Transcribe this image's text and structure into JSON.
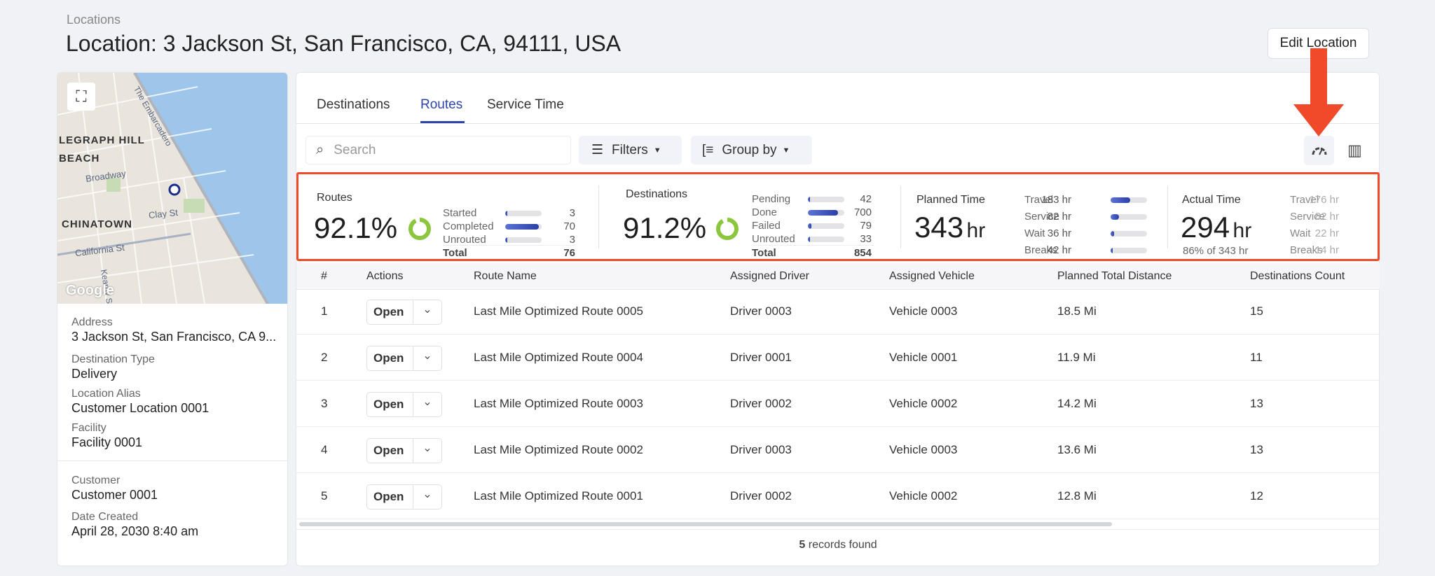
{
  "breadcrumb": "Locations",
  "page_title": "Location: 3 Jackson St, San Francisco, CA, 94111, USA",
  "edit_button": "Edit Location",
  "map": {
    "labels": [
      "LEGRAPH HILL",
      "BEACH",
      "Broadway",
      "CHINATOWN",
      "Clay St",
      "California St",
      "The Embarcadero",
      "Kearny St"
    ],
    "logo": "Google"
  },
  "details": [
    {
      "label": "Address",
      "value": "3 Jackson St, San Francisco, CA 9..."
    },
    {
      "label": "Destination Type",
      "value": "Delivery"
    },
    {
      "label": "Location Alias",
      "value": "Customer Location 0001"
    },
    {
      "label": "Facility",
      "value": "Facility 0001"
    },
    {
      "label": "Customer",
      "value": "Customer 0001"
    },
    {
      "label": "Date Created",
      "value": "April 28, 2030 8:40 am"
    }
  ],
  "tabs": [
    {
      "label": "Destinations"
    },
    {
      "label": "Routes",
      "active": true
    },
    {
      "label": "Service Time"
    }
  ],
  "toolbar": {
    "search_placeholder": "Search",
    "filters": "Filters",
    "group_by": "Group by"
  },
  "summary": {
    "routes": {
      "title": "Routes",
      "percent": "92.1%",
      "rows": [
        {
          "label": "Started",
          "value": "3",
          "fill": 0.04
        },
        {
          "label": "Completed",
          "value": "70",
          "fill": 0.92
        },
        {
          "label": "Unrouted",
          "value": "3",
          "fill": 0.04
        }
      ],
      "total_label": "Total",
      "total": "76"
    },
    "destinations": {
      "title": "Destinations",
      "percent": "91.2%",
      "rows": [
        {
          "label": "Pending",
          "value": "42",
          "fill": 0.05
        },
        {
          "label": "Done",
          "value": "700",
          "fill": 0.82
        },
        {
          "label": "Failed",
          "value": "79",
          "fill": 0.09
        },
        {
          "label": "Unrouted",
          "value": "33",
          "fill": 0.04
        }
      ],
      "total_label": "Total",
      "total": "854"
    },
    "planned": {
      "title": "Planned Time",
      "value": "343",
      "unit": "hr",
      "rows": [
        {
          "label": "Travel",
          "value": "183 hr",
          "fill": 0.53
        },
        {
          "label": "Service",
          "value": "82 hr",
          "fill": 0.24
        },
        {
          "label": "Wait",
          "value": "36 hr",
          "fill": 0.1
        },
        {
          "label": "Breaks",
          "value": "42 hr",
          "fill": 0.05
        }
      ]
    },
    "actual": {
      "title": "Actual Time",
      "value": "294",
      "unit": "hr",
      "sub": "86% of 343 hr",
      "rows": [
        {
          "label": "Travel",
          "value": "176 hr"
        },
        {
          "label": "Service",
          "value": "82 hr"
        },
        {
          "label": "Wait",
          "value": "22 hr"
        },
        {
          "label": "Breaks",
          "value": "14 hr"
        }
      ]
    }
  },
  "table": {
    "headers": [
      "#",
      "Actions",
      "Route Name",
      "Assigned Driver",
      "Assigned Vehicle",
      "Planned Total Distance",
      "Destinations Count"
    ],
    "open_label": "Open",
    "rows": [
      [
        "1",
        "Last Mile Optimized Route 0005",
        "Driver 0003",
        "Vehicle 0003",
        "18.5 Mi",
        "15"
      ],
      [
        "2",
        "Last Mile Optimized Route 0004",
        "Driver 0001",
        "Vehicle 0001",
        "11.9 Mi",
        "11"
      ],
      [
        "3",
        "Last Mile Optimized Route 0003",
        "Driver 0002",
        "Vehicle 0002",
        "14.2 Mi",
        "13"
      ],
      [
        "4",
        "Last Mile Optimized Route 0002",
        "Driver 0003",
        "Vehicle 0003",
        "13.6 Mi",
        "13"
      ],
      [
        "5",
        "Last Mile Optimized Route 0001",
        "Driver 0002",
        "Vehicle 0002",
        "12.8 Mi",
        "12"
      ]
    ]
  },
  "footer": {
    "count": "5",
    "text": "records found"
  },
  "colors": {
    "accent": "#2b46a8",
    "highlight": "#f04a2b",
    "donut": "#8cc63f"
  }
}
